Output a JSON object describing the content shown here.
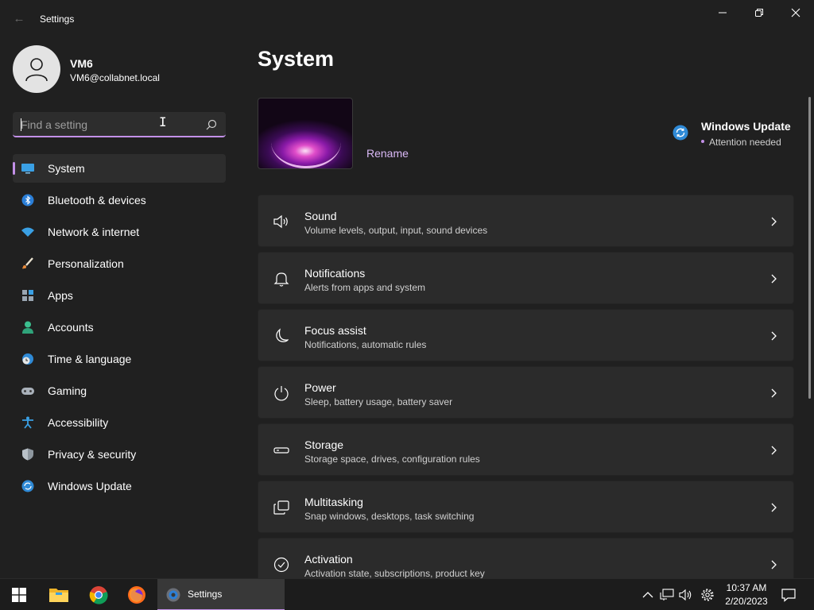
{
  "window": {
    "app_title": "Settings",
    "controls": [
      "minimize",
      "maximize",
      "close"
    ]
  },
  "user": {
    "name": "VM6",
    "email": "VM6@collabnet.local"
  },
  "search": {
    "placeholder": "Find a setting",
    "value": ""
  },
  "sidebar": {
    "items": [
      {
        "label": "System",
        "icon": "monitor-icon",
        "active": true
      },
      {
        "label": "Bluetooth & devices",
        "icon": "bluetooth-icon"
      },
      {
        "label": "Network & internet",
        "icon": "wifi-icon"
      },
      {
        "label": "Personalization",
        "icon": "brush-icon"
      },
      {
        "label": "Apps",
        "icon": "apps-icon"
      },
      {
        "label": "Accounts",
        "icon": "person-icon"
      },
      {
        "label": "Time & language",
        "icon": "globe-clock-icon"
      },
      {
        "label": "Gaming",
        "icon": "gamepad-icon"
      },
      {
        "label": "Accessibility",
        "icon": "accessibility-icon"
      },
      {
        "label": "Privacy & security",
        "icon": "shield-icon"
      },
      {
        "label": "Windows Update",
        "icon": "update-icon"
      }
    ]
  },
  "main": {
    "title": "System",
    "rename_label": "Rename",
    "windows_update": {
      "title": "Windows Update",
      "status": "Attention needed"
    },
    "cards": [
      {
        "title": "Sound",
        "desc": "Volume levels, output, input, sound devices",
        "icon": "speaker-icon"
      },
      {
        "title": "Notifications",
        "desc": "Alerts from apps and system",
        "icon": "bell-icon"
      },
      {
        "title": "Focus assist",
        "desc": "Notifications, automatic rules",
        "icon": "moon-icon"
      },
      {
        "title": "Power",
        "desc": "Sleep, battery usage, battery saver",
        "icon": "power-icon"
      },
      {
        "title": "Storage",
        "desc": "Storage space, drives, configuration rules",
        "icon": "storage-icon"
      },
      {
        "title": "Multitasking",
        "desc": "Snap windows, desktops, task switching",
        "icon": "multitasking-icon"
      },
      {
        "title": "Activation",
        "desc": "Activation state, subscriptions, product key",
        "icon": "check-circle-icon"
      }
    ]
  },
  "taskbar": {
    "active_app_label": "Settings",
    "time": "10:37 AM",
    "date": "2/20/2023"
  },
  "colors": {
    "accent": "#c390e8",
    "background": "#202020",
    "card": "#2b2b2b",
    "taskbar": "#1c1c1c"
  }
}
